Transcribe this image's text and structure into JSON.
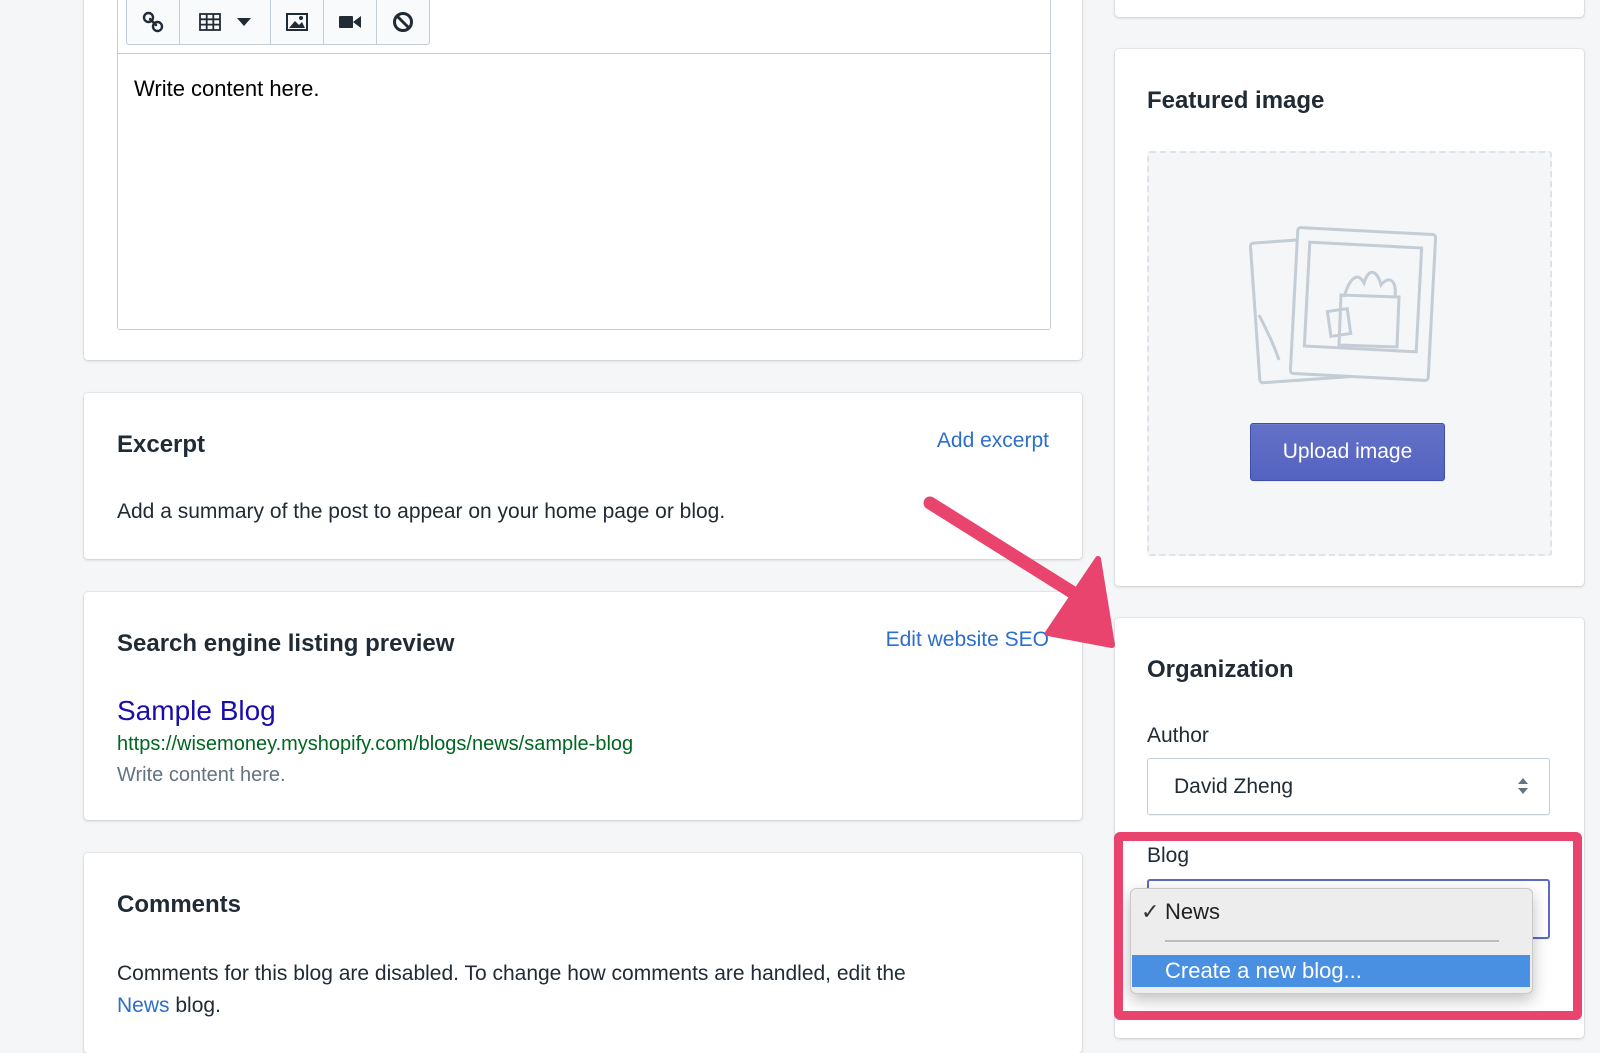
{
  "editor": {
    "toolbar": [
      {
        "name": "link-icon"
      },
      {
        "name": "table-icon"
      },
      {
        "name": "image-icon"
      },
      {
        "name": "video-icon"
      },
      {
        "name": "clear-format-icon"
      }
    ],
    "content": "Write content here."
  },
  "excerpt": {
    "title": "Excerpt",
    "action": "Add excerpt",
    "description": "Add a summary of the post to appear on your home page or blog."
  },
  "seo": {
    "title": "Search engine listing preview",
    "action": "Edit website SEO",
    "preview_title": "Sample Blog",
    "preview_url": "https://wisemoney.myshopify.com/blogs/news/sample-blog",
    "preview_description": "Write content here."
  },
  "comments": {
    "title": "Comments",
    "text_before": "Comments for this blog are disabled. To change how comments are handled, edit the",
    "link": "News",
    "text_after": "blog."
  },
  "featured_image": {
    "title": "Featured image",
    "button": "Upload image"
  },
  "organization": {
    "title": "Organization",
    "author_label": "Author",
    "author_value": "David Zheng",
    "blog_label": "Blog",
    "blog_options": {
      "checkmark": "✓",
      "selected": "News",
      "create": "Create a new blog..."
    }
  },
  "colors": {
    "accent": "#5c6ac4",
    "link": "#2c6ecb",
    "seo_title": "#1a0dab",
    "seo_url": "#006621",
    "highlight": "#e8446e",
    "dropdown_highlight": "#4a90e2"
  }
}
